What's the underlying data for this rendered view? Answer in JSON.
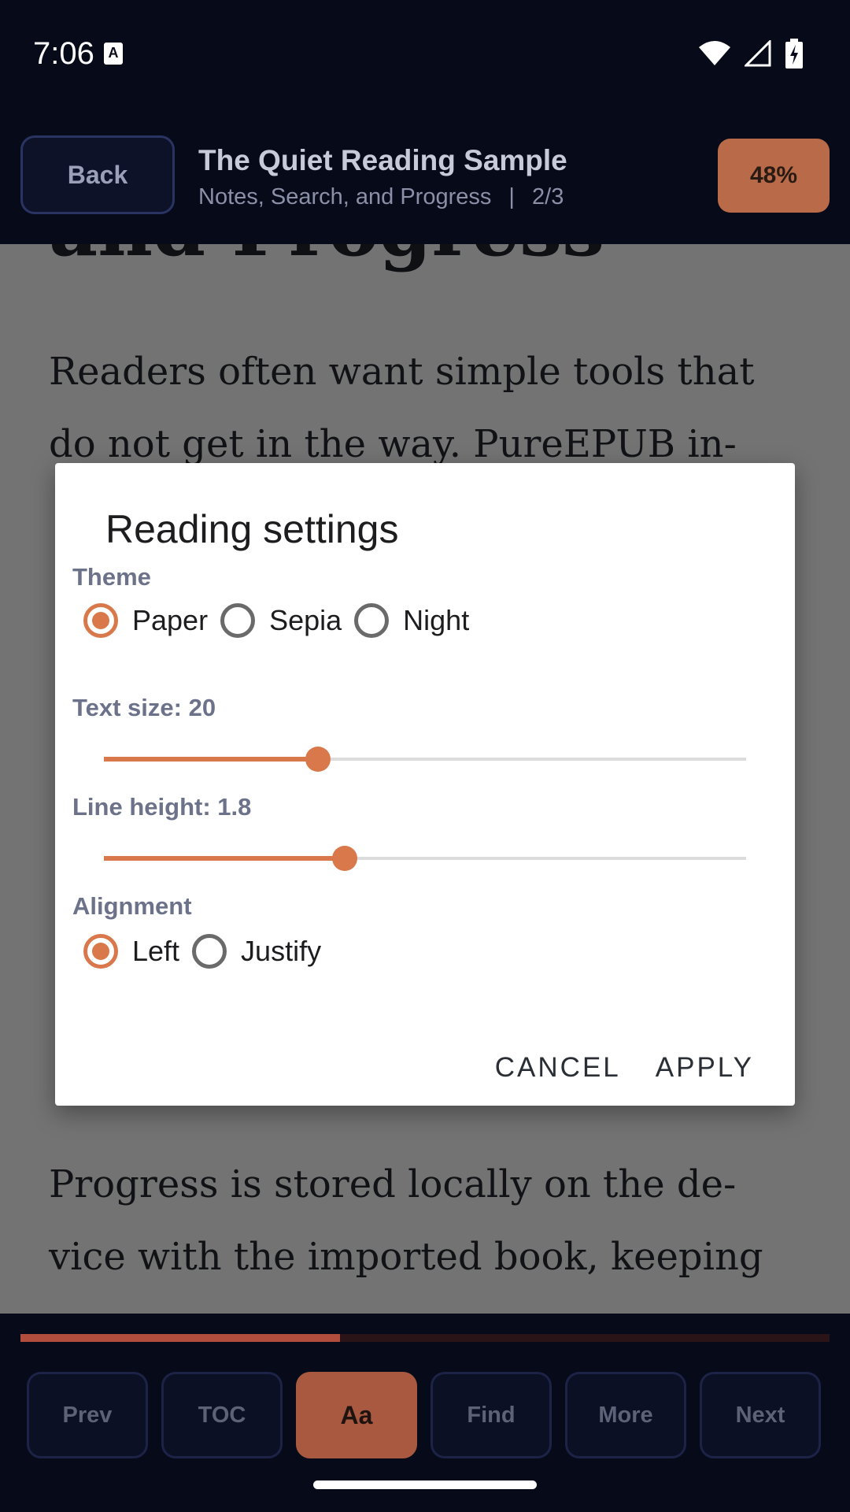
{
  "status_bar": {
    "time": "7:06",
    "notification_icon": "a-badge-icon",
    "icons": [
      "wifi-icon",
      "cell-signal-icon",
      "battery-charging-icon"
    ]
  },
  "top_bar": {
    "back_label": "Back",
    "book_title": "The Quiet Reading Sample",
    "chapter_title": "Notes, Search, and Progress",
    "separator": "|",
    "page_indicator": "2/3",
    "progress_label": "48%"
  },
  "reader": {
    "heading": "and Progress",
    "paragraph_1": [
      "Readers often want simple tools that",
      "do not get in the way. PureEPUB in-"
    ],
    "paragraph_2": [
      "Progress is stored locally on the de-",
      "vice with the imported book, keeping"
    ]
  },
  "dialog": {
    "title": "Reading settings",
    "theme": {
      "label": "Theme",
      "options": [
        {
          "label": "Paper",
          "checked": true
        },
        {
          "label": "Sepia",
          "checked": false
        },
        {
          "label": "Night",
          "checked": false
        }
      ]
    },
    "text_size": {
      "label": "Text size: 20",
      "fraction": 0.333
    },
    "line_height": {
      "label": "Line height: 1.8",
      "fraction": 0.375
    },
    "alignment": {
      "label": "Alignment",
      "options": [
        {
          "label": "Left",
          "checked": true
        },
        {
          "label": "Justify",
          "checked": false
        }
      ]
    },
    "cancel_label": "CANCEL",
    "apply_label": "APPLY"
  },
  "bottom_bar": {
    "reading_progress_fraction": 0.395,
    "buttons": [
      {
        "label": "Prev",
        "active": false
      },
      {
        "label": "TOC",
        "active": false
      },
      {
        "label": "Aa",
        "active": true
      },
      {
        "label": "Find",
        "active": false
      },
      {
        "label": "More",
        "active": false
      },
      {
        "label": "Next",
        "active": false
      }
    ]
  },
  "colors": {
    "accent": "#d9784a",
    "background": "#070a18",
    "progress_chip": "#b96b49"
  }
}
